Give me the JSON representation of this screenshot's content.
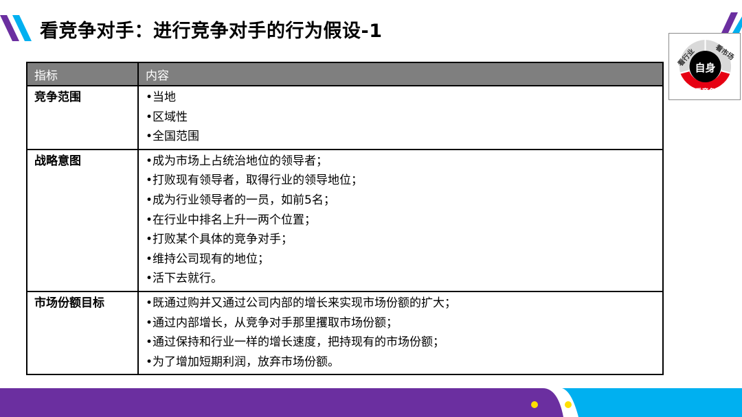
{
  "title": "看竞争对手：进行竞争对手的行为假设-1",
  "badge": {
    "center": "自身",
    "segments": [
      "看行业",
      "看市场",
      "看竞争"
    ],
    "colors": {
      "ring": "#d9d9d9",
      "active": "#e60012",
      "core": "#000000"
    }
  },
  "table": {
    "headers": [
      "指标",
      "内容"
    ],
    "rows": [
      {
        "metric": "竞争范围",
        "items": [
          "•当地",
          "•区域性",
          "•全国范围"
        ]
      },
      {
        "metric": "战略意图",
        "items": [
          "•成为市场上占统治地位的领导者；",
          "•打败现有领导者，取得行业的领导地位；",
          "•成为行业领导者的一员，如前5名；",
          "•在行业中排名上升一两个位置；",
          "•打败某个具体的竞争对手；",
          "•维持公司现有的地位；",
          "•活下去就行。"
        ]
      },
      {
        "metric": "市场份额目标",
        "items": [
          "•既通过购并又通过公司内部的增长来实现市场份额的扩大；",
          "•通过内部增长，从竞争对手那里攫取市场份额；",
          "•通过保持和行业一样的增长速度，把持现有的市场份额；",
          "•为了增加短期利润，放弃市场份额。"
        ]
      }
    ]
  },
  "colors": {
    "purple": "#6b2fa0",
    "cyan": "#00b0f0",
    "yellow": "#ffe000",
    "header_bg": "#7f7f7f"
  }
}
